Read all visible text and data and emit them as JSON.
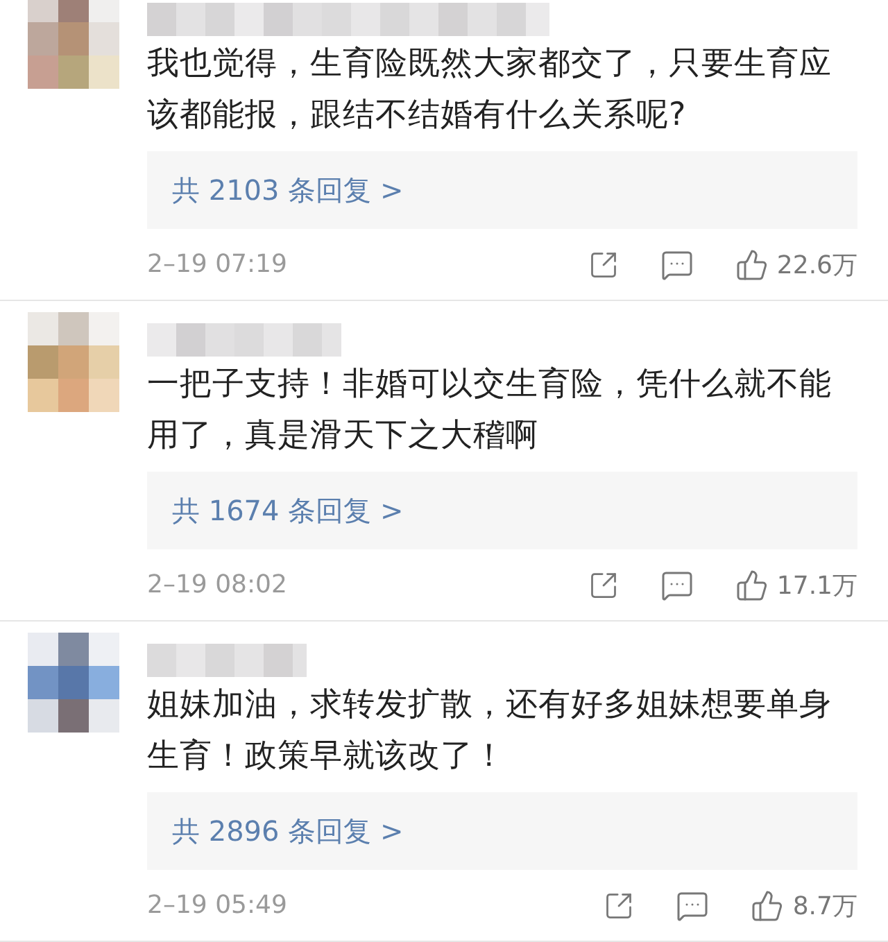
{
  "comments": [
    {
      "text": "我也觉得，生育险既然大家都交了，只要生育应该都能报，跟结不结婚有什么关系呢?",
      "replies": "共 2103 条回复 >",
      "time": "2–19 07:19",
      "likes": "22.6万"
    },
    {
      "text": "一把子支持！非婚可以交生育险，凭什么就不能用了，真是滑天下之大稽啊",
      "replies": "共 1674 条回复 >",
      "time": "2–19 08:02",
      "likes": "17.1万"
    },
    {
      "text": "姐妹加油，求转发扩散，还有好多姐妹想要单身生育！政策早就该改了！",
      "replies": "共 2896 条回复 >",
      "time": "2–19 05:49",
      "likes": "8.7万"
    }
  ]
}
